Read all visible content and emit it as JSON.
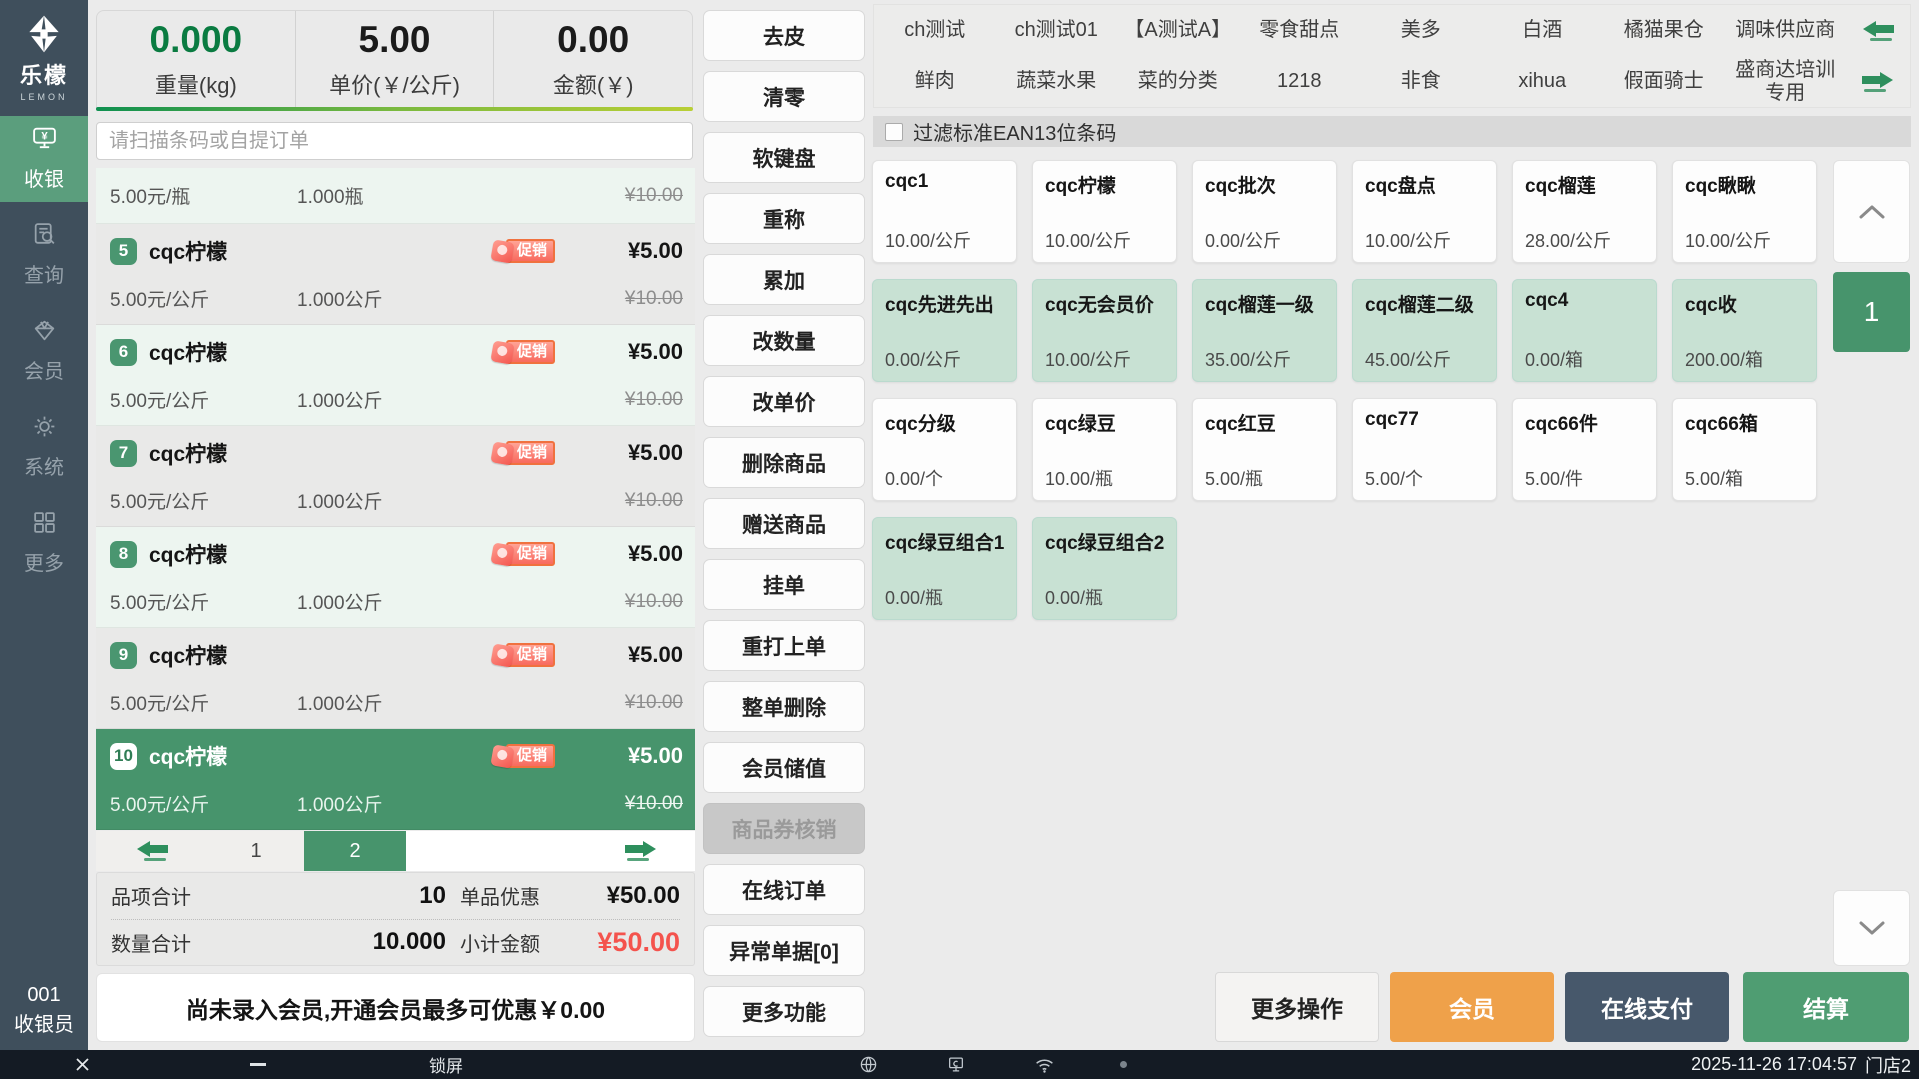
{
  "sidebar": {
    "logo": {
      "title": "乐檬",
      "subtitle": "LEMON"
    },
    "items": [
      {
        "label": "收银",
        "icon": "cash-register-icon",
        "active": true
      },
      {
        "label": "查询",
        "icon": "search-doc-icon",
        "active": false
      },
      {
        "label": "会员",
        "icon": "member-diamond-icon",
        "active": false
      },
      {
        "label": "系统",
        "icon": "gear-icon",
        "active": false
      },
      {
        "label": "更多",
        "icon": "more-grid-icon",
        "active": false
      }
    ],
    "cashier_id": "001",
    "cashier_role": "收银员"
  },
  "scale": {
    "weight_value": "0.000",
    "weight_label": "重量(kg)",
    "price_value": "5.00",
    "price_label": "单价(￥/公斤)",
    "amount_value": "0.00",
    "amount_label": "金额(￥)"
  },
  "search": {
    "placeholder": "请扫描条码或自提订单"
  },
  "cart": {
    "carryover_row": {
      "unit_price": "5.00元/瓶",
      "quantity": "1.000瓶",
      "original_price": "¥10.00"
    },
    "items": [
      {
        "index": "5",
        "name": "cqc柠檬",
        "promo_label": "促销",
        "price": "¥5.00",
        "unit_price": "5.00元/公斤",
        "quantity": "1.000公斤",
        "original_price": "¥10.00",
        "selected": false,
        "shade": "gray"
      },
      {
        "index": "6",
        "name": "cqc柠檬",
        "promo_label": "促销",
        "price": "¥5.00",
        "unit_price": "5.00元/公斤",
        "quantity": "1.000公斤",
        "original_price": "¥10.00",
        "selected": false,
        "shade": "green"
      },
      {
        "index": "7",
        "name": "cqc柠檬",
        "promo_label": "促销",
        "price": "¥5.00",
        "unit_price": "5.00元/公斤",
        "quantity": "1.000公斤",
        "original_price": "¥10.00",
        "selected": false,
        "shade": "gray"
      },
      {
        "index": "8",
        "name": "cqc柠檬",
        "promo_label": "促销",
        "price": "¥5.00",
        "unit_price": "5.00元/公斤",
        "quantity": "1.000公斤",
        "original_price": "¥10.00",
        "selected": false,
        "shade": "green"
      },
      {
        "index": "9",
        "name": "cqc柠檬",
        "promo_label": "促销",
        "price": "¥5.00",
        "unit_price": "5.00元/公斤",
        "quantity": "1.000公斤",
        "original_price": "¥10.00",
        "selected": false,
        "shade": "gray"
      },
      {
        "index": "10",
        "name": "cqc柠檬",
        "promo_label": "促销",
        "price": "¥5.00",
        "unit_price": "5.00元/公斤",
        "quantity": "1.000公斤",
        "original_price": "¥10.00",
        "selected": true,
        "shade": "selected"
      }
    ]
  },
  "cart_pager": {
    "pages": [
      "1",
      "2"
    ],
    "active_page": "2"
  },
  "totals": {
    "items_label": "品项合计",
    "items_value": "10",
    "discount_label": "单品优惠",
    "discount_value": "¥50.00",
    "qty_label": "数量合计",
    "qty_value": "10.000",
    "subtotal_label": "小计金额",
    "subtotal_value": "¥50.00"
  },
  "member_notice": "尚未录入会员,开通会员最多可优惠￥0.00",
  "action_buttons": [
    {
      "label": "去皮"
    },
    {
      "label": "清零"
    },
    {
      "label": "软键盘"
    },
    {
      "label": "重称"
    },
    {
      "label": "累加"
    },
    {
      "label": "改数量"
    },
    {
      "label": "改单价"
    },
    {
      "label": "删除商品"
    },
    {
      "label": "赠送商品"
    },
    {
      "label": "挂单"
    },
    {
      "label": "重打上单"
    },
    {
      "label": "整单删除"
    },
    {
      "label": "会员储值"
    },
    {
      "label": "商品券核销",
      "disabled": true
    },
    {
      "label": "在线订单"
    },
    {
      "label": "异常单据[0]"
    },
    {
      "label": "更多功能"
    }
  ],
  "category_tabs": {
    "row1": [
      "ch测试",
      "ch测试01",
      "【A测试A】",
      "零食甜点",
      "美多",
      "白酒",
      "橘猫果仓",
      "调味供应商"
    ],
    "row2": [
      "鲜肉",
      "蔬菜水果",
      "菜的分类",
      "1218",
      "非食",
      "xihua",
      "假面骑士",
      "盛商达培训专用"
    ]
  },
  "barcode_filter": {
    "label": "过滤标准EAN13位条码",
    "checked": false
  },
  "products": [
    {
      "name": "cqc1",
      "price": "10.00/公斤",
      "highlighted": false
    },
    {
      "name": "cqc柠檬",
      "price": "10.00/公斤",
      "highlighted": false
    },
    {
      "name": "cqc批次",
      "price": "0.00/公斤",
      "highlighted": false
    },
    {
      "name": "cqc盘点",
      "price": "10.00/公斤",
      "highlighted": false
    },
    {
      "name": "cqc榴莲",
      "price": "28.00/公斤",
      "highlighted": false
    },
    {
      "name": "cqc瞅瞅",
      "price": "10.00/公斤",
      "highlighted": false
    },
    {
      "name": "cqc先进先出",
      "price": "0.00/公斤",
      "highlighted": true
    },
    {
      "name": "cqc无会员价",
      "price": "10.00/公斤",
      "highlighted": true
    },
    {
      "name": "cqc榴莲一级",
      "price": "35.00/公斤",
      "highlighted": true
    },
    {
      "name": "cqc榴莲二级",
      "price": "45.00/公斤",
      "highlighted": true
    },
    {
      "name": "cqc4",
      "price": "0.00/箱",
      "highlighted": true
    },
    {
      "name": "cqc收",
      "price": "200.00/箱",
      "highlighted": true
    },
    {
      "name": "cqc分级",
      "price": "0.00/个",
      "highlighted": false
    },
    {
      "name": "cqc绿豆",
      "price": "10.00/瓶",
      "highlighted": false
    },
    {
      "name": "cqc红豆",
      "price": "5.00/瓶",
      "highlighted": false
    },
    {
      "name": "cqc77",
      "price": "5.00/个",
      "highlighted": false
    },
    {
      "name": "cqc66件",
      "price": "5.00/件",
      "highlighted": false
    },
    {
      "name": "cqc66箱",
      "price": "5.00/箱",
      "highlighted": false
    },
    {
      "name": "cqc绿豆组合1",
      "price": "0.00/瓶",
      "highlighted": true
    },
    {
      "name": "cqc绿豆组合2",
      "price": "0.00/瓶",
      "highlighted": true
    }
  ],
  "product_pager": {
    "page": "1"
  },
  "checkout": {
    "buttons": [
      {
        "label": "更多操作",
        "style": "plain"
      },
      {
        "label": "会员",
        "style": "orange"
      },
      {
        "label": "在线支付",
        "style": "dark"
      },
      {
        "label": "结算",
        "style": "green"
      }
    ]
  },
  "statusbar": {
    "lock_label": "锁屏",
    "datetime": "2025-11-26 17:04:57",
    "store": "门店2"
  },
  "colors": {
    "accent_green": "#47946c",
    "sidebar": "#3f4f5c",
    "member_orange": "#efa14a",
    "online_pay_dark": "#47586b",
    "subtotal_red": "#f4534d",
    "promo_border": "#f0713f"
  }
}
